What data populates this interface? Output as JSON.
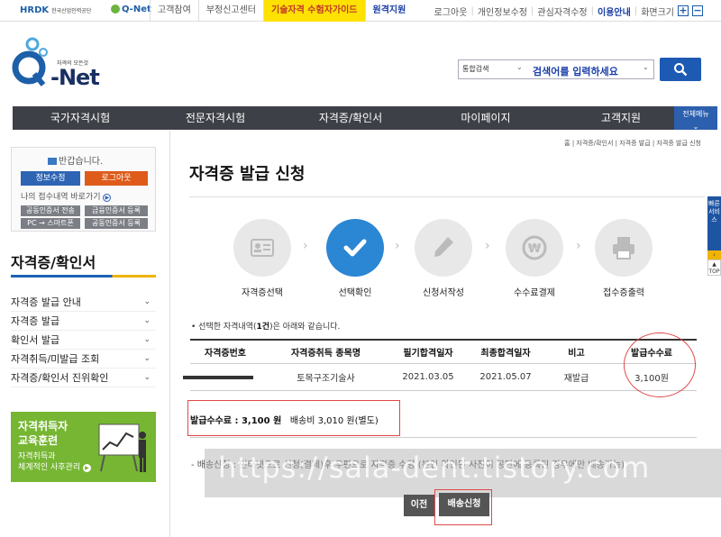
{
  "topbar": {
    "logo1": "HRDK",
    "logo1_sub": "한국산업인력공단",
    "logo2": "Q-Net",
    "links": [
      "고객참여",
      "부정신고센터",
      "기술자격 수험자가이드",
      "원격지원"
    ],
    "right_links": [
      "로그아웃",
      "개인정보수정",
      "관심자격수정",
      "이용안내",
      "화면크기"
    ],
    "zoom_plus": "+",
    "zoom_minus": "−"
  },
  "header": {
    "logo_tagline": "자격의 모든것",
    "logo_text": "-Net",
    "search_scope": "통합검색",
    "search_placeholder": "검색어를 입력하세요"
  },
  "nav": {
    "items": [
      "국가자격시험",
      "전문자격시험",
      "자격증/확인서",
      "마이페이지",
      "고객지원"
    ],
    "all_menu": "전체메뉴"
  },
  "login_box": {
    "welcome": "반갑습니다.",
    "edit_info": "정보수정",
    "logout": "로그아웃",
    "recent": "나의 접수내역 바로가기",
    "cert_transfer": "공동인증서 전송",
    "finance_cert": "금융인증서 등록",
    "pc_phone": "PC → 스마트폰",
    "public_cert": "공동인증서 등록"
  },
  "sidebar": {
    "title": "자격증/확인서",
    "items": [
      "자격증 발급 안내",
      "자격증 발급",
      "확인서 발급",
      "자격취득/미발급 조회",
      "자격증/확인서 진위확인"
    ]
  },
  "banner": {
    "title_line1": "자격취득자",
    "title_line2": "교육훈련",
    "desc_line1": "자격취득과",
    "desc_line2": "체계적인 사후관리"
  },
  "breadcrumb": "홈 | 자격증/확인서 | 자격증 발급 | 자격증 발급 신청",
  "page_title": "자격증 발급 신청",
  "steps": [
    {
      "label": "자격증선택",
      "icon": "id-card-icon",
      "active": false
    },
    {
      "label": "선택확인",
      "icon": "check-icon",
      "active": true
    },
    {
      "label": "신청서작성",
      "icon": "pencil-icon",
      "active": false
    },
    {
      "label": "수수료결제",
      "icon": "won-coin-icon",
      "active": false
    },
    {
      "label": "접수증출력",
      "icon": "printer-icon",
      "active": false
    }
  ],
  "note": {
    "prefix": "• 선택한 자격내역(",
    "count": "1건",
    "suffix": ")은 아래와 같습니다."
  },
  "table": {
    "headers": [
      "자격증번호",
      "자격증취득 종목명",
      "필기합격일자",
      "최종합격일자",
      "비고",
      "발급수수료"
    ],
    "rows": [
      {
        "cert_no": "",
        "name": "토목구조기술사",
        "written_date": "2021.03.05",
        "final_date": "2021.05.07",
        "remark": "재발급",
        "fee": "3,100원"
      }
    ]
  },
  "fee_summary": {
    "label": "발급수수료 : 3,100 원",
    "delivery": "배송비 3,010 원(별도)"
  },
  "delivery_note": "- 배송신청 : 인터넷으로 신청(결제)후 우편으로 자격증 수령 (본인 확인된 사진이 공단에 등록된 경우에만 배송가능)",
  "watermark": "https://sala-dent.tistory.com",
  "buttons": {
    "prev": "이전",
    "apply": "배송신청"
  },
  "quick": {
    "label": "빠른서비스",
    "top": "TOP"
  },
  "colors": {
    "accent_blue": "#2b86d4",
    "nav_bg": "#3d4046",
    "annotation_red": "#e04848",
    "banner_green": "#76b633"
  }
}
